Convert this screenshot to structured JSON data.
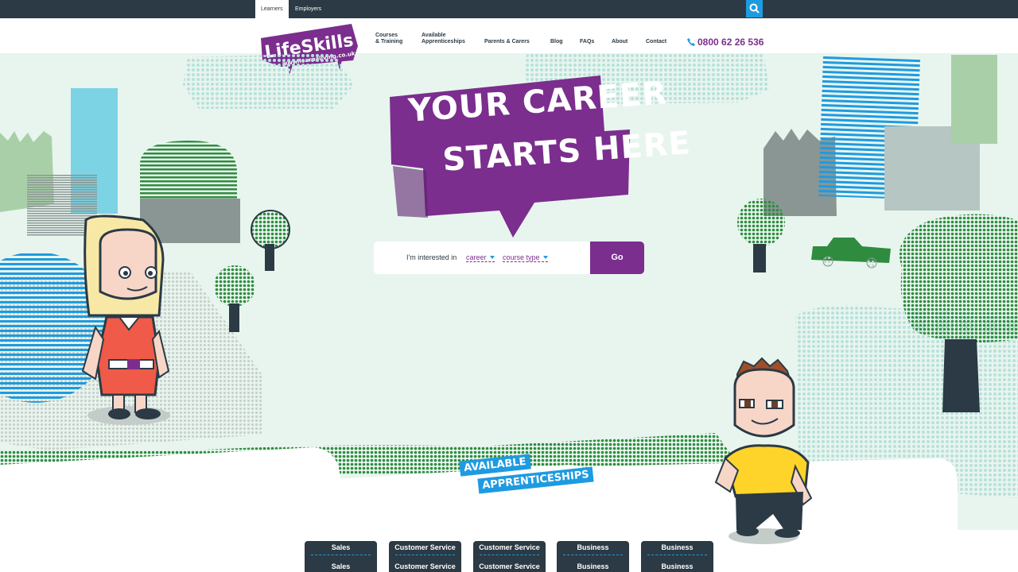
{
  "topbar": {
    "tabs": [
      {
        "label": "Learners",
        "active": true
      },
      {
        "label": "Employers",
        "active": false
      }
    ]
  },
  "header": {
    "logo": {
      "text": "LifeSkills",
      "url_text": "www.learnaliving.co.uk"
    },
    "nav": [
      {
        "label": "Courses",
        "label2": "& Training"
      },
      {
        "label": "Available",
        "label2": "Apprenticeships"
      },
      {
        "label": "Parents & Carers",
        "label2": ""
      },
      {
        "label": "Blog",
        "label2": ""
      },
      {
        "label": "FAQs",
        "label2": ""
      },
      {
        "label": "About",
        "label2": ""
      },
      {
        "label": "Contact",
        "label2": ""
      }
    ],
    "phone": "0800 62 26 536"
  },
  "hero": {
    "headline_line1": "YOUR CAREER",
    "headline_line2": "STARTS HERE",
    "search": {
      "label": "I'm interested in",
      "career": "career",
      "course_type": "course type",
      "go": "Go"
    },
    "available_line1": "AVAILABLE",
    "available_line2": "APPRENTICESHIPS"
  },
  "categories": [
    {
      "top": "Sales",
      "bottom": "Sales"
    },
    {
      "top": "Customer Service",
      "bottom": "Customer Service"
    },
    {
      "top": "Customer Service",
      "bottom": "Customer Service"
    },
    {
      "top": "Business",
      "bottom": "Business"
    },
    {
      "top": "Business",
      "bottom": "Business"
    }
  ],
  "colors": {
    "brand_purple": "#7b2e8e",
    "accent_blue": "#1e9be0",
    "dark_navy": "#2b3a44",
    "hero_bg": "#e8f5ee",
    "green": "#2f8c3f"
  },
  "icons": {
    "search": "search-icon",
    "phone": "phone-icon",
    "caret": "caret-down-icon"
  }
}
